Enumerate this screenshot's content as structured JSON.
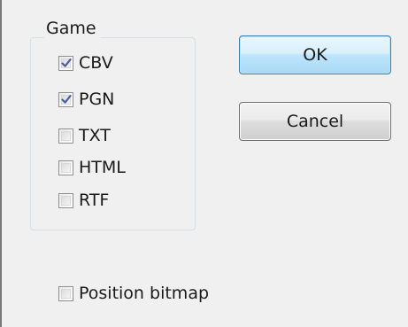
{
  "group": {
    "title": "Game",
    "options": [
      {
        "label": "CBV",
        "checked": true
      },
      {
        "label": "PGN",
        "checked": true
      },
      {
        "label": "TXT",
        "checked": false
      },
      {
        "label": "HTML",
        "checked": false
      },
      {
        "label": "RTF",
        "checked": false
      }
    ]
  },
  "position_bitmap": {
    "label": "Position bitmap",
    "checked": false
  },
  "buttons": {
    "ok_label": "OK",
    "cancel_label": "Cancel"
  },
  "colors": {
    "check_mark": "#4a5f97",
    "ok_border": "#3c7fb1",
    "background": "#f0f0f0"
  },
  "icons": {
    "checked": "check-mark-icon"
  }
}
